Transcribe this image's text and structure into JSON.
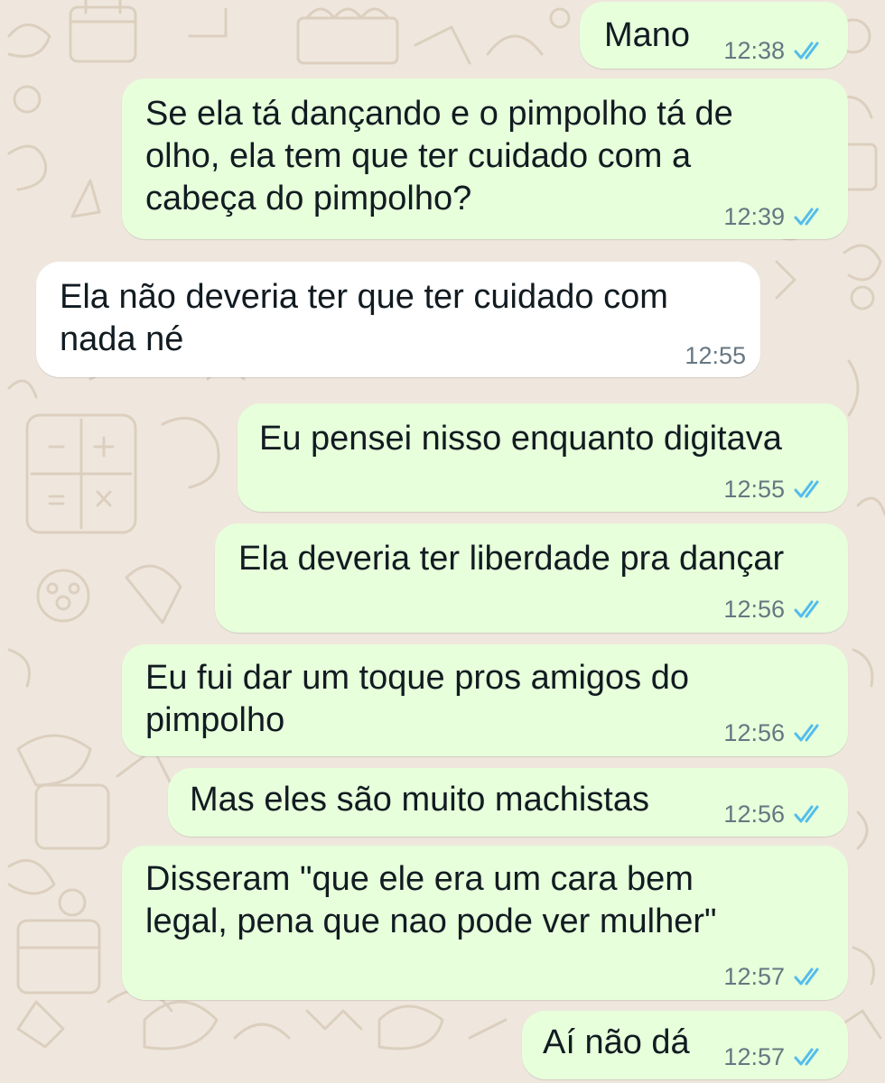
{
  "colors": {
    "outgoing_bubble": "#e7ffdb",
    "incoming_bubble": "#ffffff",
    "background": "#efe7dd",
    "read_ticks": "#53bdeb",
    "timestamp": "#667781"
  },
  "icons": {
    "read_receipt": "double-check-icon"
  },
  "messages": [
    {
      "direction": "outgoing",
      "text": "Mano",
      "time": "12:38",
      "status": "read"
    },
    {
      "direction": "outgoing",
      "text": "Se ela tá dançando e o pimpolho tá de\nolho, ela tem que ter cuidado com a\ncabeça do pimpolho?",
      "time": "12:39",
      "status": "read"
    },
    {
      "direction": "incoming",
      "text": "Ela não deveria ter que ter cuidado com\nnada né",
      "time": "12:55"
    },
    {
      "direction": "outgoing",
      "text": "Eu pensei nisso enquanto digitava",
      "time": "12:55",
      "status": "read"
    },
    {
      "direction": "outgoing",
      "text": "Ela deveria ter liberdade pra dançar",
      "time": "12:56",
      "status": "read"
    },
    {
      "direction": "outgoing",
      "text": "Eu fui dar um toque pros amigos do\npimpolho",
      "time": "12:56",
      "status": "read"
    },
    {
      "direction": "outgoing",
      "text": "Mas eles são muito machistas",
      "time": "12:56",
      "status": "read"
    },
    {
      "direction": "outgoing",
      "text": "Disseram \"que ele era um cara bem\nlegal, pena que nao pode ver mulher\"",
      "time": "12:57",
      "status": "read"
    },
    {
      "direction": "outgoing",
      "text": "Aí não dá",
      "time": "12:57",
      "status": "read"
    }
  ]
}
